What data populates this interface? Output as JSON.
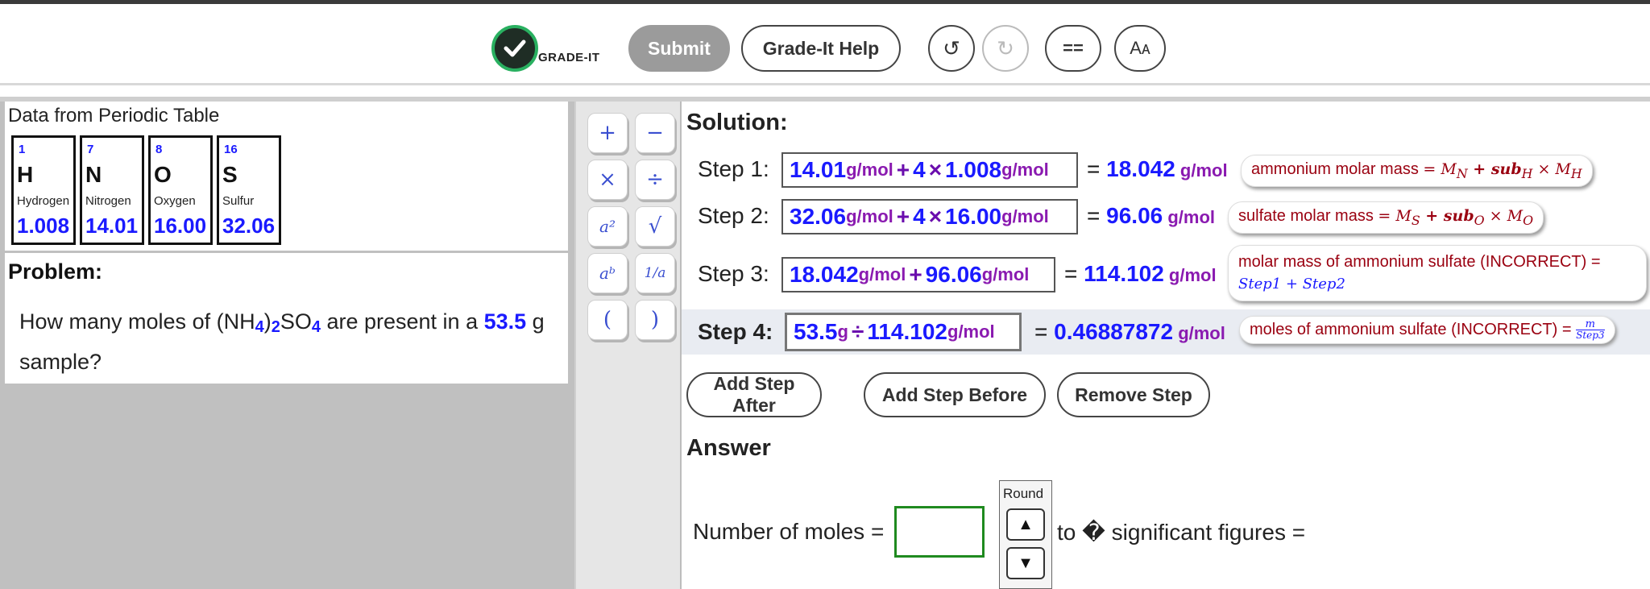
{
  "header": {
    "logo_text": "GRADE-IT",
    "submit_label": "Submit",
    "help_label": "Grade-It Help",
    "undo_icon": "↺",
    "redo_icon": "↻",
    "eq_label": "==",
    "font_label": "Aᴀ"
  },
  "periodic_table": {
    "title": "Data from Periodic Table",
    "elements": [
      {
        "number": "1",
        "symbol": "H",
        "name": "Hydrogen",
        "mass": "1.008"
      },
      {
        "number": "7",
        "symbol": "N",
        "name": "Nitrogen",
        "mass": "14.01"
      },
      {
        "number": "8",
        "symbol": "O",
        "name": "Oxygen",
        "mass": "16.00"
      },
      {
        "number": "16",
        "symbol": "S",
        "name": "Sulfur",
        "mass": "32.06"
      }
    ]
  },
  "problem": {
    "title": "Problem:",
    "text_before": "How many moles of (NH",
    "sub1": "4",
    "text_mid1": ")",
    "sub2": "2",
    "text_mid2": "SO",
    "sub3": "4",
    "text_mid3": " are present in a ",
    "mass_value": "53.5",
    "text_after": " g sample?"
  },
  "keypad": {
    "plus": "+",
    "minus": "−",
    "times": "×",
    "divide": "÷",
    "square": "a²",
    "sqrt": "√",
    "power": "aᵇ",
    "reciprocal": "1/a",
    "lparen": "(",
    "rparen": ")"
  },
  "solution": {
    "title": "Solution:",
    "steps": [
      {
        "label": "Step 1:",
        "expr": [
          {
            "t": "num",
            "v": "14.01"
          },
          {
            "t": "unit",
            "v": " g/mol "
          },
          {
            "t": "op",
            "v": "+"
          },
          {
            "t": "num",
            "v": "4"
          },
          {
            "t": "op",
            "v": "×"
          },
          {
            "t": "num",
            "v": "1.008"
          },
          {
            "t": "unit",
            "v": " g/mol"
          }
        ],
        "eq": "=",
        "result_value": "18.042",
        "result_unit": " g/mol",
        "note_text": "ammonium molar mass ",
        "note_formula": "= M",
        "note_formula_sub1": "N",
        "note_formula2": " + sub",
        "note_formula_sub2": "H",
        "note_formula3": " × M",
        "note_formula_sub3": "H"
      },
      {
        "label": "Step 2:",
        "expr": [
          {
            "t": "num",
            "v": "32.06"
          },
          {
            "t": "unit",
            "v": " g/mol "
          },
          {
            "t": "op",
            "v": "+"
          },
          {
            "t": "num",
            "v": "4"
          },
          {
            "t": "op",
            "v": "×"
          },
          {
            "t": "num",
            "v": "16.00"
          },
          {
            "t": "unit",
            "v": " g/mol"
          }
        ],
        "eq": "=",
        "result_value": "96.06",
        "result_unit": " g/mol",
        "note_text": "sulfate molar mass ",
        "note_formula": "= M",
        "note_formula_sub1": "S",
        "note_formula2": " + sub",
        "note_formula_sub2": "O",
        "note_formula3": " × M",
        "note_formula_sub3": "O"
      },
      {
        "label": "Step 3:",
        "expr": [
          {
            "t": "num",
            "v": "18.042"
          },
          {
            "t": "unit",
            "v": " g/mol "
          },
          {
            "t": "op",
            "v": "+"
          },
          {
            "t": "num",
            "v": "96.06"
          },
          {
            "t": "unit",
            "v": " g/mol"
          }
        ],
        "eq": "=",
        "result_value": "114.102",
        "result_unit": " g/mol",
        "note_line1": "molar mass of ammonium sulfate (INCORRECT)  =",
        "note_line2": "Step1 + Step2"
      },
      {
        "label": "Step 4:",
        "expr": [
          {
            "t": "num",
            "v": "53.5"
          },
          {
            "t": "unit",
            "v": " g "
          },
          {
            "t": "op",
            "v": "÷"
          },
          {
            "t": "num",
            "v": "114.102"
          },
          {
            "t": "unit",
            "v": " g/mol"
          }
        ],
        "eq": "=",
        "result_value": "0.46887872",
        "result_unit": " g/mol",
        "note_text": "moles of ammonium sulfate (INCORRECT) = ",
        "note_frac_num": "m",
        "note_frac_den": "Step3"
      }
    ],
    "add_after_label": "Add Step After",
    "add_before_label": "Add Step Before",
    "remove_label": "Remove Step"
  },
  "answer": {
    "title": "Answer",
    "label": "Number of moles =",
    "input_value": "",
    "round_label": "Round",
    "up_icon": "▲",
    "down_icon": "▼",
    "sigfig_text": "to � significant figures ="
  }
}
